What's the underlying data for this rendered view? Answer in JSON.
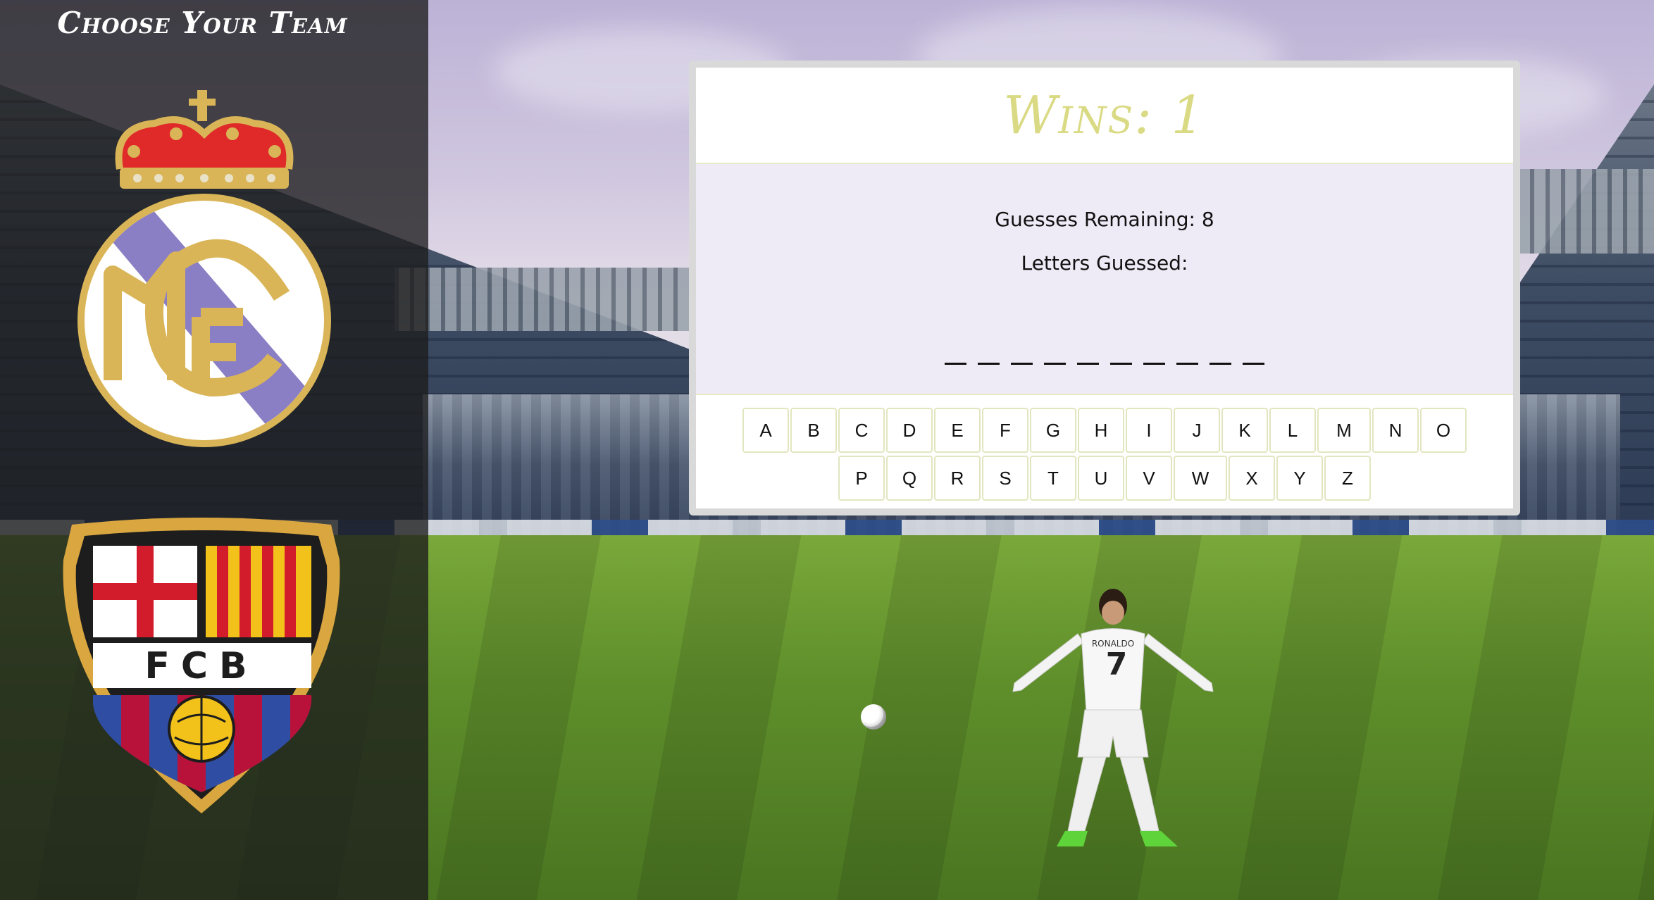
{
  "sidebar": {
    "title": "Choose Your Team",
    "teams": [
      {
        "name": "Real Madrid",
        "crest_letters": "MCF"
      },
      {
        "name": "FC Barcelona",
        "crest_letters": "FCB"
      }
    ]
  },
  "game": {
    "wins_label": "Wins: 1",
    "guesses_remaining_label": "Guesses Remaining: 8",
    "letters_guessed_label": "Letters Guessed:",
    "word_blank_count": 10,
    "keyboard": {
      "row1": [
        "A",
        "B",
        "C",
        "D",
        "E",
        "F",
        "G",
        "H",
        "I",
        "J",
        "K",
        "L",
        "M",
        "N",
        "O"
      ],
      "row2": [
        "P",
        "Q",
        "R",
        "S",
        "T",
        "U",
        "V",
        "W",
        "X",
        "Y",
        "Z"
      ]
    }
  },
  "player": {
    "jersey_number": "7",
    "jersey_name": "RONALDO"
  },
  "colors": {
    "wins_text": "#dada84",
    "panel_body_bg": "#eeeaf6",
    "key_border": "#e2e6bf",
    "sidebar_bg": "rgba(28,28,28,0.78)",
    "rm_accent": "#8a7fc4",
    "rm_gold": "#d9b558",
    "fcb_red": "#b8123a",
    "fcb_blue": "#2f4ea3",
    "fcb_yellow": "#f2c21a"
  }
}
